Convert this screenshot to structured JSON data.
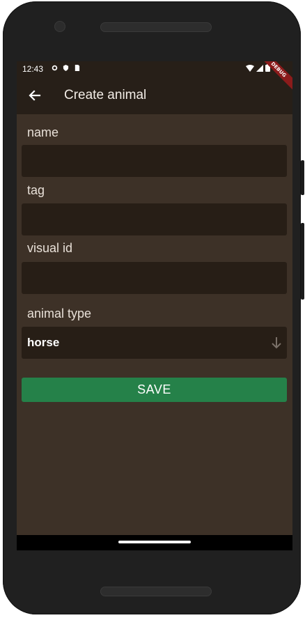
{
  "status_bar": {
    "time": "12:43"
  },
  "app_bar": {
    "title": "Create animal",
    "debug_label": "DEBUG"
  },
  "form": {
    "name_label": "name",
    "tag_label": "tag",
    "visual_id_label": "visual id",
    "animal_type_label": "animal type",
    "animal_type_value": "horse"
  },
  "actions": {
    "save_label": "SAVE"
  },
  "colors": {
    "background": "#3d3127",
    "app_bar": "#271f18",
    "field": "#271e16",
    "save_button": "#258149"
  }
}
